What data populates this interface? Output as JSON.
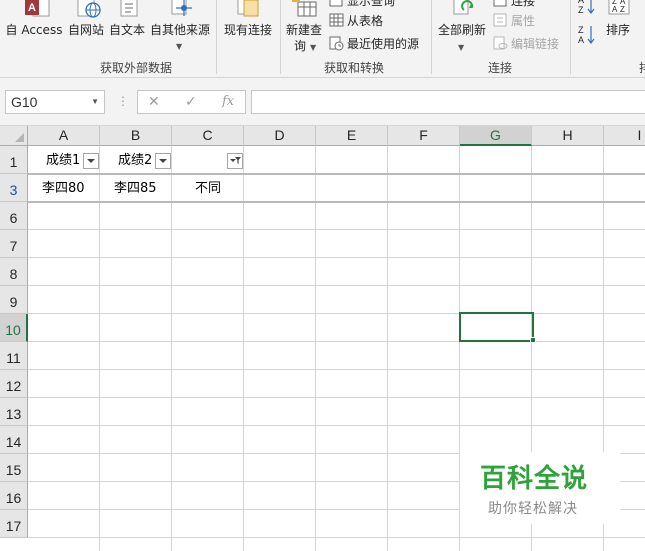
{
  "ribbon": {
    "get_external": {
      "buttons": [
        {
          "id": "access",
          "label": "自 Access",
          "icon": "access-db-icon"
        },
        {
          "id": "web",
          "label": "自网站",
          "icon": "web-globe-icon"
        },
        {
          "id": "text",
          "label": "自文本",
          "icon": "text-file-icon"
        },
        {
          "id": "other",
          "label": "自其他来源",
          "icon": "other-sources-icon"
        }
      ],
      "label": "获取外部数据"
    },
    "existing_connections": {
      "label": "现有连接",
      "icon": "existing-connections-icon"
    },
    "get_transform": {
      "new_query_line1": "新建查",
      "new_query_line2": "询",
      "show_queries": "显示查询",
      "from_table": "从表格",
      "recent_sources": "最近使用的源",
      "label": "获取和转换"
    },
    "connections": {
      "refresh_all": "全部刷新",
      "connections": "连接",
      "properties": "属性",
      "edit_links": "编辑链接",
      "label": "连接"
    },
    "sort": {
      "label": "排序",
      "az_top": "A",
      "az_bottom": "Z",
      "za_top": "Z",
      "za_bottom": "A"
    },
    "cut_off_label": "排"
  },
  "formula_bar": {
    "name_box": "G10",
    "dots": "⋮",
    "cancel": "✕",
    "enter": "✓",
    "fx": "fx",
    "formula": ""
  },
  "sheet": {
    "columns": [
      "A",
      "B",
      "C",
      "D",
      "E",
      "F",
      "G",
      "H",
      "I"
    ],
    "selected_column": "G",
    "rows": [
      "1",
      "3",
      "6",
      "7",
      "8",
      "9",
      "10",
      "11",
      "12",
      "13",
      "14",
      "15",
      "16",
      "17"
    ],
    "selected_row": "10",
    "filtered_row": "3",
    "header_cells": {
      "A1": "成绩1",
      "B1": "成绩2",
      "C1": ""
    },
    "data_cells": {
      "A3": "李四80",
      "B3": "李四85",
      "C3": "不同"
    },
    "active_cell": "G10"
  },
  "watermark": {
    "title": "百科全说",
    "subtitle": "助你轻松解决"
  },
  "colors": {
    "excel_green": "#217346",
    "watermark_green": "#2fa33b",
    "filtered_row_blue": "#1f4e9c"
  }
}
